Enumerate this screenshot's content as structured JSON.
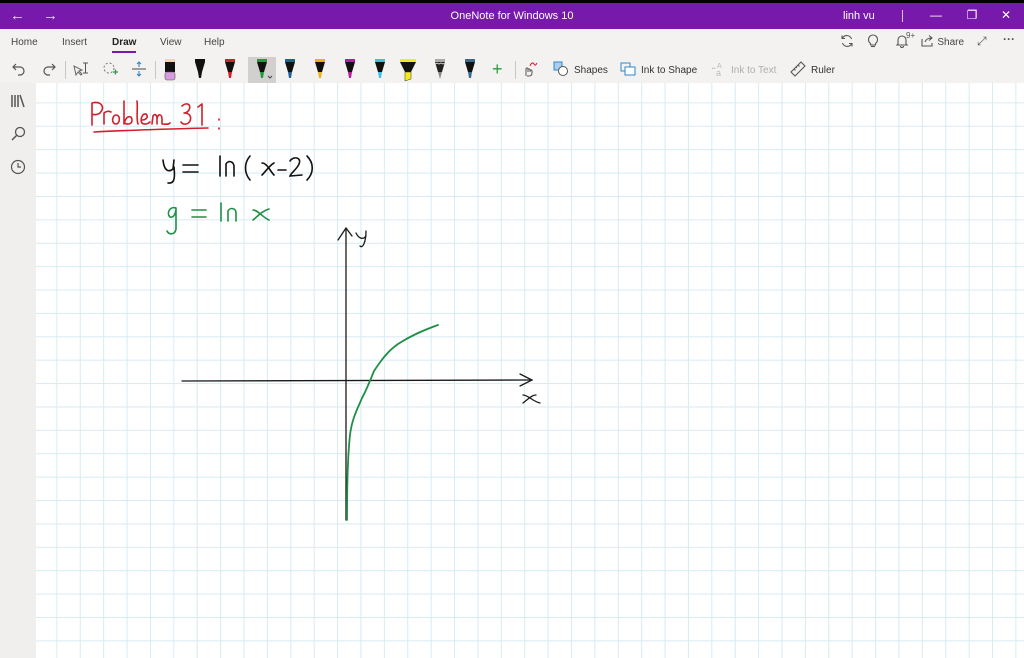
{
  "titlebar": {
    "back_icon": "←",
    "forward_icon": "→",
    "title": "OneNote for Windows 10",
    "user": "linh vu",
    "minimize_icon": "—",
    "restore_icon": "❐",
    "close_icon": "✕",
    "color": "#7719aa"
  },
  "ribbon": {
    "tabs": [
      {
        "label": "Home"
      },
      {
        "label": "Insert"
      },
      {
        "label": "Draw",
        "active": true
      },
      {
        "label": "View"
      },
      {
        "label": "Help"
      }
    ],
    "right_controls": {
      "sync_icon": "⟳",
      "ideas_icon": "💡",
      "notifications_badge": "9+",
      "share_label": "Share",
      "expand_icon": "⤢",
      "more_icon": "···"
    }
  },
  "draw_toolbar": {
    "undo_icon": "↶",
    "redo_icon": "↷",
    "pens": [
      {
        "type": "eraser",
        "color": "#d79be0"
      },
      {
        "type": "pen",
        "color": "#111111"
      },
      {
        "type": "pen",
        "color": "#d21f2b"
      },
      {
        "type": "pen",
        "color": "#1e9b3c",
        "selected": true
      },
      {
        "type": "pen",
        "color": "#1f5f9b"
      },
      {
        "type": "pen",
        "color": "#e8b21e"
      },
      {
        "type": "pen",
        "color": "#b21e9b"
      },
      {
        "type": "pen",
        "color": "#3cbfe8"
      },
      {
        "type": "highlighter",
        "color": "#f7ea1c"
      },
      {
        "type": "pencil",
        "color": "#888888"
      },
      {
        "type": "pen",
        "color": "#3a6b8a"
      }
    ],
    "add_pen_icon": "+",
    "shapes_label": "Shapes",
    "ink_to_shape_label": "Ink to Shape",
    "ink_to_text_label": "Ink to Text",
    "ruler_label": "Ruler"
  },
  "page": {
    "heading": "Problem 31 :",
    "equation_1": "y = ln(x-2)",
    "equation_2": "g = ln x",
    "axis_x_label": "x",
    "axis_y_label": "y",
    "heading_color": "#d21f2b",
    "eq1_color": "#111111",
    "eq2_color": "#1e8f45",
    "curve_color": "#1e8f45"
  }
}
